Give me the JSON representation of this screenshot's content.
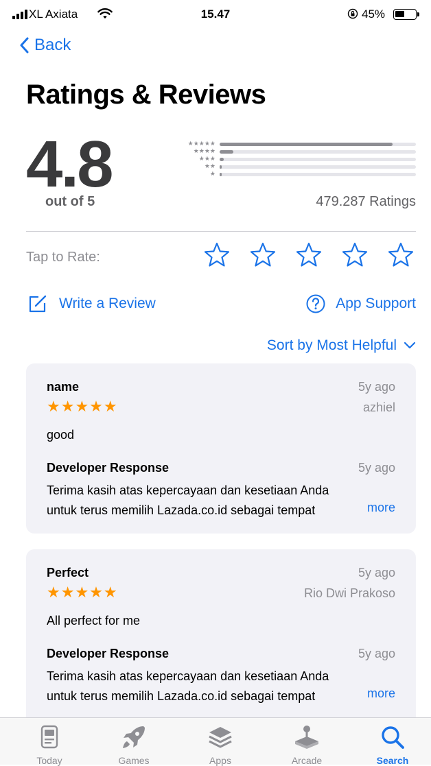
{
  "status_bar": {
    "carrier": "XL Axiata",
    "time": "15.47",
    "battery": "45%",
    "battery_level": 0.45
  },
  "nav": {
    "back_label": "Back"
  },
  "page": {
    "title": "Ratings & Reviews"
  },
  "summary": {
    "average": "4.8",
    "out_of": "out of 5",
    "ratings_count": "479.287 Ratings",
    "histogram": [
      {
        "stars": 5,
        "fraction": 0.88
      },
      {
        "stars": 4,
        "fraction": 0.07
      },
      {
        "stars": 3,
        "fraction": 0.02
      },
      {
        "stars": 2,
        "fraction": 0.01
      },
      {
        "stars": 1,
        "fraction": 0.01
      }
    ]
  },
  "tap_to_rate": {
    "label": "Tap to Rate:"
  },
  "actions": {
    "write_review": "Write a Review",
    "app_support": "App Support"
  },
  "sort": {
    "label": "Sort by Most Helpful"
  },
  "reviews": [
    {
      "title": "name",
      "date": "5y ago",
      "author": "azhiel",
      "stars": "★★★★★",
      "body": "good",
      "dev_heading": "Developer Response",
      "dev_date": "5y ago",
      "dev_line1": "Terima kasih atas kepercayaan dan kesetiaan Anda",
      "dev_line2": "untuk terus memilih Lazada.co.id sebagai tempat",
      "more": "more"
    },
    {
      "title": "Perfect",
      "date": "5y ago",
      "author": "Rio Dwi Prakoso",
      "stars": "★★★★★",
      "body": "All perfect for me",
      "dev_heading": "Developer Response",
      "dev_date": "5y ago",
      "dev_line1": "Terima kasih atas kepercayaan dan kesetiaan Anda",
      "dev_line2": "untuk terus memilih Lazada.co.id sebagai tempat",
      "more": "more"
    }
  ],
  "tab_bar": {
    "today": "Today",
    "games": "Games",
    "apps": "Apps",
    "arcade": "Arcade",
    "search": "Search",
    "active": "search"
  },
  "colors": {
    "accent": "#1a73e8",
    "star": "#ff9500",
    "card": "#f2f2f7"
  }
}
